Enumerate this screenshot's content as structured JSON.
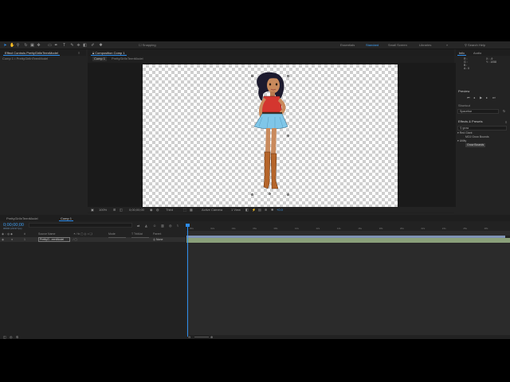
{
  "toolbar": {
    "snapping_label": "Snapping",
    "workspaces": [
      "Essentials",
      "Standard",
      "Small Screen",
      "Libraries"
    ],
    "active_workspace": "Standard",
    "search_placeholder": "Search Help"
  },
  "project_panel": {
    "tab_label": "Effect Controls PrettyGirlInTeenModel",
    "subtitle": "Comp 1 • PrettyGirlInTeenModel"
  },
  "composition_panel": {
    "tab_label": "Composition Comp 1",
    "subtabs": [
      "Comp 1",
      "PrettyGirlInTeenModel"
    ]
  },
  "viewer_controls": {
    "zoom": "100%",
    "timecode": "0;00;00;00",
    "resolution": "Third",
    "camera": "Active Camera",
    "views": "1 View",
    "exposure": "+0.0"
  },
  "info_panel": {
    "tabs": [
      "Info",
      "Audio"
    ],
    "values": [
      "R :",
      "G :",
      "B :",
      "A : 0",
      "X : -9",
      "Y : 1058"
    ]
  },
  "preview_panel": {
    "title": "Preview"
  },
  "shortcut": {
    "label": "Shortcut",
    "value": "Spacebar"
  },
  "effects_panel": {
    "title": "Effects & Presets",
    "search_value": "grow",
    "tree": [
      {
        "label": "▾ Red Giant",
        "indent": 0,
        "selected": false
      },
      {
        "label": "MOJ Grow Bounds",
        "indent": 2,
        "selected": false
      },
      {
        "label": "▾ Utility",
        "indent": 0,
        "selected": false
      },
      {
        "label": "Grow Bounds",
        "indent": 2,
        "selected": true
      }
    ]
  },
  "timeline": {
    "tabs": [
      "PrettyGirlInTeenModel",
      "Comp 1"
    ],
    "active_tab": "Comp 1",
    "timecode": "0;00;00;00",
    "timecode_sub": "00000 (29.97 fps)",
    "columns": [
      "Source Name",
      "Mode",
      "T TrkMat",
      "Parent"
    ],
    "layer": {
      "number": "1",
      "name": "PrettyG...eenModel",
      "parent": "None"
    },
    "ruler_labels": [
      "00s",
      "02s",
      "04s",
      "06s",
      "08s",
      "10s",
      "12s",
      "14s",
      "16s",
      "18s",
      "20s",
      "22s",
      "24s",
      "26s",
      "28s"
    ]
  },
  "colors": {
    "accent": "#2d8ceb",
    "panel_bg": "#232323",
    "layer_bar": "#8aa07a"
  }
}
